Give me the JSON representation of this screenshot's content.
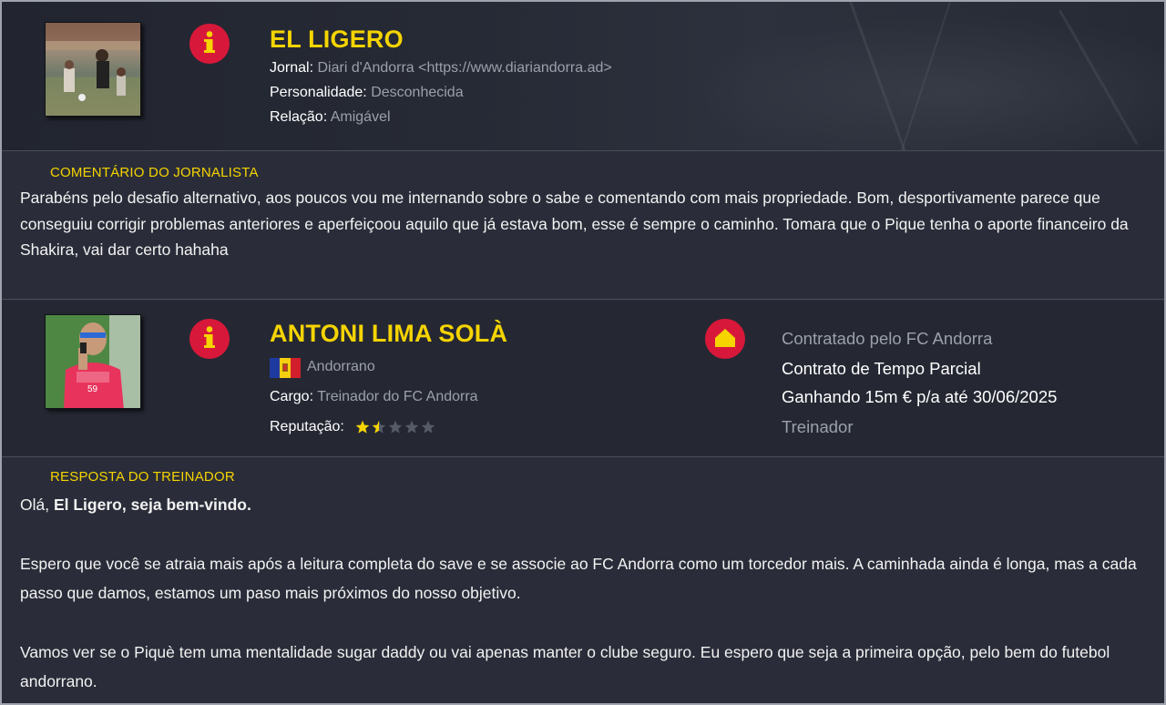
{
  "journalist": {
    "name": "EL LIGERO",
    "journal_label": "Jornal:",
    "journal_value": "Diari d'Andorra <https://www.diariandorra.ad>",
    "personality_label": "Personalidade:",
    "personality_value": "Desconhecida",
    "relation_label": "Relação:",
    "relation_value": "Amigável"
  },
  "comment": {
    "label": "COMENTÁRIO DO JORNALISTA",
    "text": "Parabéns pelo desafio alternativo, aos poucos vou me internando sobre o sabe e comentando com mais propriedade. Bom, desportivamente parece que conseguiu corrigir problemas anteriores e aperfeiçoou aquilo que já estava bom, esse é sempre o caminho. Tomara que o Pique tenha o aporte financeiro da Shakira, vai dar certo hahaha"
  },
  "manager": {
    "name": "ANTONI LIMA SOLÀ",
    "nationality": "Andorrano",
    "role_label": "Cargo:",
    "role_value": "Treinador do FC Andorra",
    "reputation_label": "Reputação:",
    "reputation_stars": 1.5,
    "reputation_max": 5,
    "contract": {
      "hired_by": "Contratado pelo FC Andorra",
      "type": "Contrato de Tempo Parcial",
      "salary": "Ganhando 15m € p/a até 30/06/2025",
      "position": "Treinador"
    }
  },
  "response": {
    "label": "RESPOSTA DO TREINADOR",
    "greeting_plain": "Olá, ",
    "greeting_bold": "El Ligero, seja bem-vindo.",
    "paragraph1": "Espero que você se atraia mais após a leitura completa do save e se associe ao FC Andorra como um torcedor mais. A caminhada ainda é longa, mas a cada passo que damos, estamos um paso mais próximos do nosso objetivo.",
    "paragraph2": "Vamos ver se o Piquè tem uma mentalidade sugar daddy ou vai apenas manter o clube seguro. Eu espero que seja a primeira opção, pelo bem do futebol andorrano."
  },
  "colors": {
    "accent_yellow": "#f5d400",
    "badge_red": "#d8183a",
    "muted_text": "#9aa0ab",
    "star_empty": "#555a66"
  },
  "icons": {
    "journalist_info": "info-icon",
    "manager_info": "info-icon",
    "club_home": "home-icon",
    "nationality_flag": "andorra-flag-icon"
  }
}
